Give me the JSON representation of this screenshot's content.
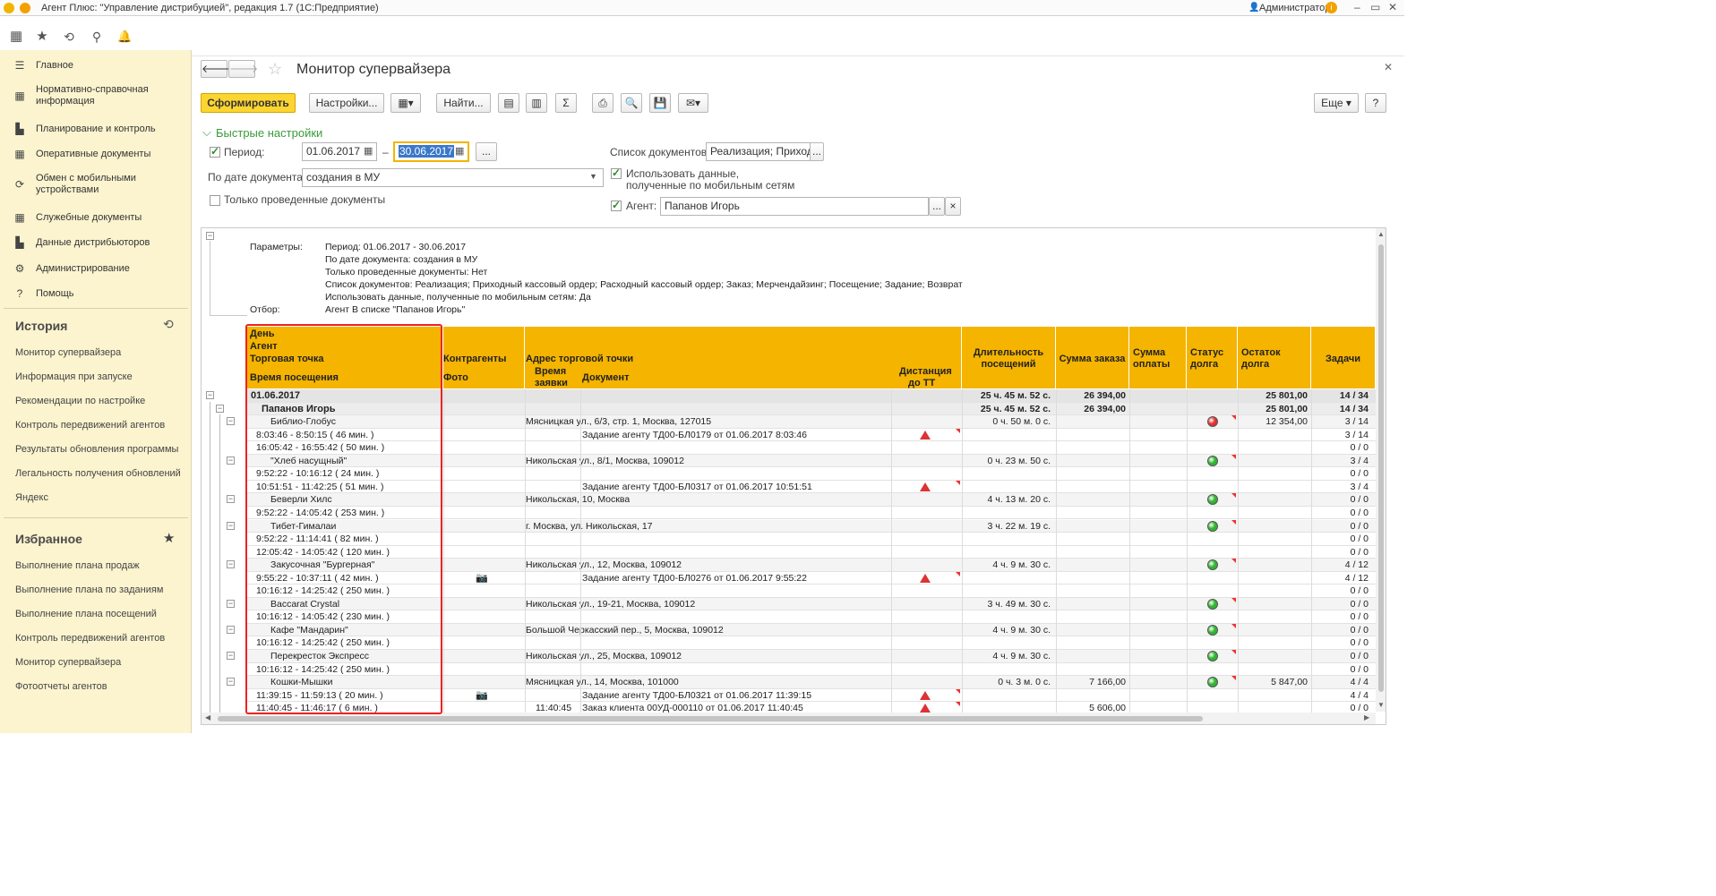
{
  "window": {
    "title": "Агент Плюс: \"Управление дистрибуцией\", редакция 1.7 (1С:Предприятие)",
    "user": "Администратор"
  },
  "sidebar": {
    "items": [
      {
        "label": "Главное",
        "icon": "menu-icon"
      },
      {
        "label": "Нормативно-справочная информация",
        "icon": "grid-icon"
      },
      {
        "label": "Планирование и контроль",
        "icon": "chart-icon"
      },
      {
        "label": "Оперативные документы",
        "icon": "grid-icon"
      },
      {
        "label": "Обмен с мобильными устройствами",
        "icon": "sync-icon"
      },
      {
        "label": "Служебные документы",
        "icon": "grid-icon"
      },
      {
        "label": "Данные дистрибьюторов",
        "icon": "chart-icon"
      },
      {
        "label": "Администрирование",
        "icon": "gear-icon"
      },
      {
        "label": "Помощь",
        "icon": "help-icon"
      }
    ],
    "history_title": "История",
    "history": [
      "Монитор супервайзера",
      "Информация при запуске",
      "Рекомендации по настройке",
      "Контроль передвижений агентов",
      "Результаты обновления программы",
      "Легальность получения обновлений",
      "Яндекс"
    ],
    "favorites_title": "Избранное",
    "favorites": [
      "Выполнение плана продаж",
      "Выполнение плана по заданиям",
      "Выполнение плана посещений",
      "Контроль передвижений агентов",
      "Монитор супервайзера",
      "Фотоотчеты агентов"
    ]
  },
  "form": {
    "title": "Монитор супервайзера",
    "buttons": {
      "generate": "Сформировать",
      "settings": "Настройки...",
      "find": "Найти...",
      "more": "Еще",
      "help": "?"
    },
    "quick_settings": "Быстрые настройки",
    "period_label": "Период:",
    "period_from": "01.06.2017",
    "period_dash": "–",
    "period_to": "30.06.2017",
    "ellipsis": "...",
    "by_date_label": "По дате документа:",
    "by_date_value": "создания в МУ",
    "only_posted_label": "Только проведенные документы",
    "doc_list_label": "Список документов:",
    "doc_list_value": "Реализация; Приходный",
    "use_mobile_label1": "Использовать данные,",
    "use_mobile_label2": "полученные по мобильным сетям",
    "agent_label": "Агент:",
    "agent_value": "Папанов Игорь",
    "clear": "×"
  },
  "report": {
    "params": {
      "label": "Параметры:",
      "lines": [
        "Период: 01.06.2017 - 30.06.2017",
        "По дате документа: создания в МУ",
        "Только проведенные документы: Нет",
        "Список документов: Реализация; Приходный кассовый ордер; Расходный кассовый ордер; Заказ; Мерчендайзинг; Посещение; Задание; Возврат",
        "Использовать данные, полученные по мобильным сетям: Да"
      ],
      "filter_label": "Отбор:",
      "filter_value": "Агент В списке \"Папанов Игорь\""
    },
    "headers": {
      "day": "День",
      "agent": "Агент",
      "outlet": "Торговая точка",
      "visit_time": "Время посещения",
      "counterparties": "Контрагенты",
      "photo": "Фото",
      "address": "Адрес торговой точки",
      "order_time1": "Время",
      "order_time2": "заявки",
      "document": "Документ",
      "distance1": "Дистанция",
      "distance2": "до ТТ",
      "duration1": "Длительность",
      "duration2": "посещений",
      "order_sum": "Сумма заказа",
      "pay_sum1": "Сумма",
      "pay_sum2": "оплаты",
      "debt_status1": "Статус",
      "debt_status2": "долга",
      "debt_rest1": "Остаток",
      "debt_rest2": "долга",
      "tasks": "Задачи"
    },
    "rows": [
      {
        "kind": "day",
        "label": "01.06.2017",
        "duration": "25 ч. 45 м. 52 с.",
        "order": "26 394,00",
        "rest": "25 801,00",
        "tasks": "14 / 34"
      },
      {
        "kind": "agent",
        "label": "Папанов Игорь",
        "duration": "25 ч. 45 м. 52 с.",
        "order": "26 394,00",
        "rest": "25 801,00",
        "tasks": "14 / 34"
      },
      {
        "kind": "outlet",
        "label": "Библио-Глобус",
        "address": "Мясницкая ул., 6/3, стр. 1, Москва, 127015",
        "duration": "0 ч. 50 м. 0 с.",
        "status": "red",
        "rest": "12 354,00",
        "tasks": "3 / 14"
      },
      {
        "kind": "visit",
        "label": "8:03:46 - 8:50:15 ( 46 мин. )",
        "doc": "Задание агенту ТД00-БЛ0179 от 01.06.2017 8:03:46",
        "dist": true,
        "tasks": "3 / 14"
      },
      {
        "kind": "visit",
        "label": "16:05:42 - 16:55:42 ( 50 мин. )",
        "tasks": "0 / 0"
      },
      {
        "kind": "outlet",
        "label": "\"Хлеб насущный\"",
        "address": "Никольская ул., 8/1, Москва, 109012",
        "duration": "0 ч. 23 м. 50 с.",
        "status": "green",
        "tasks": "3 / 4"
      },
      {
        "kind": "visit",
        "label": "9:52:22 - 10:16:12 ( 24 мин. )",
        "tasks": "0 / 0"
      },
      {
        "kind": "visit",
        "label": "10:51:51 - 11:42:25 ( 51 мин. )",
        "doc": "Задание агенту ТД00-БЛ0317 от 01.06.2017 10:51:51",
        "dist": true,
        "tasks": "3 / 4"
      },
      {
        "kind": "outlet",
        "label": "Беверли Хилс",
        "address": "Никольская, 10, Москва",
        "duration": "4 ч. 13 м. 20 с.",
        "status": "green",
        "tasks": "0 / 0"
      },
      {
        "kind": "visit",
        "label": "9:52:22 - 14:05:42 ( 253 мин. )",
        "tasks": "0 / 0"
      },
      {
        "kind": "outlet",
        "label": "Тибет-Гималаи",
        "address": "г. Москва, ул. Никольская, 17",
        "duration": "3 ч. 22 м. 19 с.",
        "status": "green",
        "tasks": "0 / 0"
      },
      {
        "kind": "visit",
        "label": "9:52:22 - 11:14:41 ( 82 мин. )",
        "tasks": "0 / 0"
      },
      {
        "kind": "visit",
        "label": "12:05:42 - 14:05:42 ( 120 мин. )",
        "tasks": "0 / 0"
      },
      {
        "kind": "outlet",
        "label": "Закусочная \"Бургерная\"",
        "address": "Никольская ул., 12, Москва, 109012",
        "duration": "4 ч. 9 м. 30 с.",
        "status": "green",
        "tasks": "4 / 12"
      },
      {
        "kind": "visit",
        "label": "9:55:22 - 10:37:11 ( 42 мин. )",
        "photo": true,
        "doc": "Задание агенту ТД00-БЛ0276 от 01.06.2017 9:55:22",
        "dist": true,
        "tasks": "4 / 12"
      },
      {
        "kind": "visit",
        "label": "10:16:12 - 14:25:42 ( 250 мин. )",
        "tasks": "0 / 0"
      },
      {
        "kind": "outlet",
        "label": "Baccarat Crystal",
        "address": "Никольская ул., 19-21, Москва, 109012",
        "duration": "3 ч. 49 м. 30 с.",
        "status": "green",
        "tasks": "0 / 0"
      },
      {
        "kind": "visit",
        "label": "10:16:12 - 14:05:42 ( 230 мин. )",
        "tasks": "0 / 0"
      },
      {
        "kind": "outlet",
        "label": "Кафе \"Мандарин\"",
        "address": "Большой Черкасский пер., 5, Москва, 109012",
        "duration": "4 ч. 9 м. 30 с.",
        "status": "green",
        "tasks": "0 / 0"
      },
      {
        "kind": "visit",
        "label": "10:16:12 - 14:25:42 ( 250 мин. )",
        "tasks": "0 / 0"
      },
      {
        "kind": "outlet",
        "label": "Перекресток Экспресс",
        "address": "Никольская ул., 25, Москва, 109012",
        "duration": "4 ч. 9 м. 30 с.",
        "status": "green",
        "tasks": "0 / 0"
      },
      {
        "kind": "visit",
        "label": "10:16:12 - 14:25:42 ( 250 мин. )",
        "tasks": "0 / 0"
      },
      {
        "kind": "outlet",
        "label": "Кошки-Мышки",
        "address": "Мясницкая ул., 14, Москва, 101000",
        "duration": "0 ч. 3 м. 0 с.",
        "order": "7 166,00",
        "status": "green",
        "rest": "5 847,00",
        "tasks": "4 / 4"
      },
      {
        "kind": "visit",
        "label": "11:39:15 - 11:59:13 ( 20 мин. )",
        "photo": true,
        "doc": "Задание агенту ТД00-БЛ0321 от 01.06.2017 11:39:15",
        "dist": true,
        "tasks": "4 / 4"
      },
      {
        "kind": "visit",
        "label": "11:40:45 - 11:46:17 ( 6 мин. )",
        "otime": "11:40:45",
        "doc": "Заказ клиента 00УД-000110 от 01.06.2017 11:40:45",
        "dist": true,
        "order": "5 606,00",
        "tasks": "0 / 0"
      }
    ]
  },
  "colors": {
    "header": "#f5b400",
    "day_row": "#e6e6e6",
    "green": "#2fb52f",
    "red": "#e03030"
  }
}
